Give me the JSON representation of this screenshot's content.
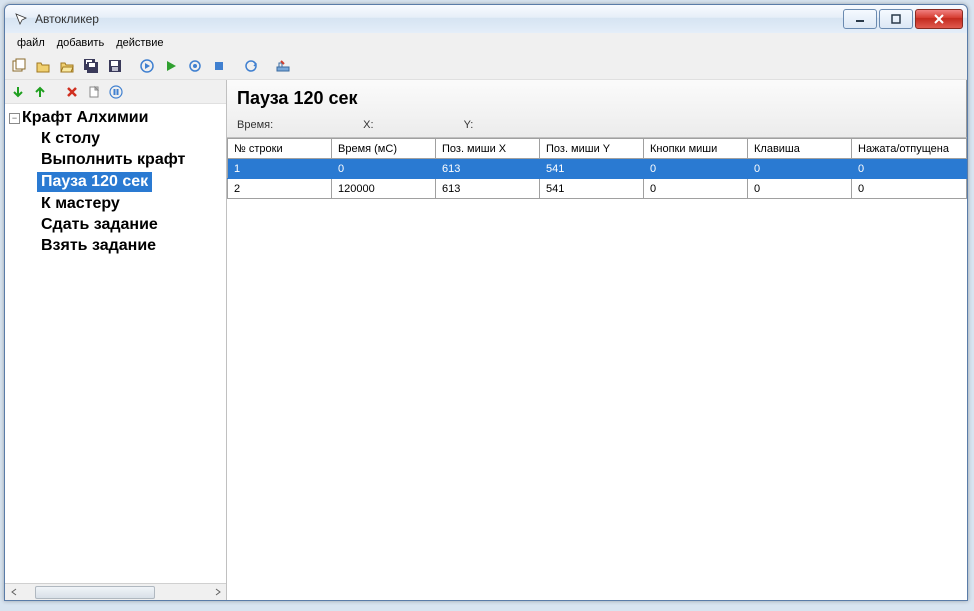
{
  "window": {
    "title": "Автокликер"
  },
  "menu": {
    "file": "файл",
    "add": "добавить",
    "action": "действие"
  },
  "sidebar": {
    "root": "Крафт Алхимии",
    "items": [
      {
        "label": "К столу"
      },
      {
        "label": "Выполнить крафт"
      },
      {
        "label": "Пауза 120 сек",
        "selected": true
      },
      {
        "label": "К мастеру"
      },
      {
        "label": "Сдать задание"
      },
      {
        "label": "Взять задание"
      }
    ]
  },
  "detail": {
    "title": "Пауза 120 сек",
    "time_label": "Время:",
    "x_label": "X:",
    "y_label": "Y:"
  },
  "table": {
    "headers": [
      "№ строки",
      "Время (мС)",
      "Поз. миши X",
      "Поз. миши Y",
      "Кнопки миши",
      "Клавиша",
      "Нажата/отпущена"
    ],
    "rows": [
      {
        "cells": [
          "1",
          "0",
          "613",
          "541",
          "0",
          "0",
          "0"
        ],
        "selected": true
      },
      {
        "cells": [
          "2",
          "120000",
          "613",
          "541",
          "0",
          "0",
          "0"
        ],
        "selected": false
      }
    ]
  }
}
